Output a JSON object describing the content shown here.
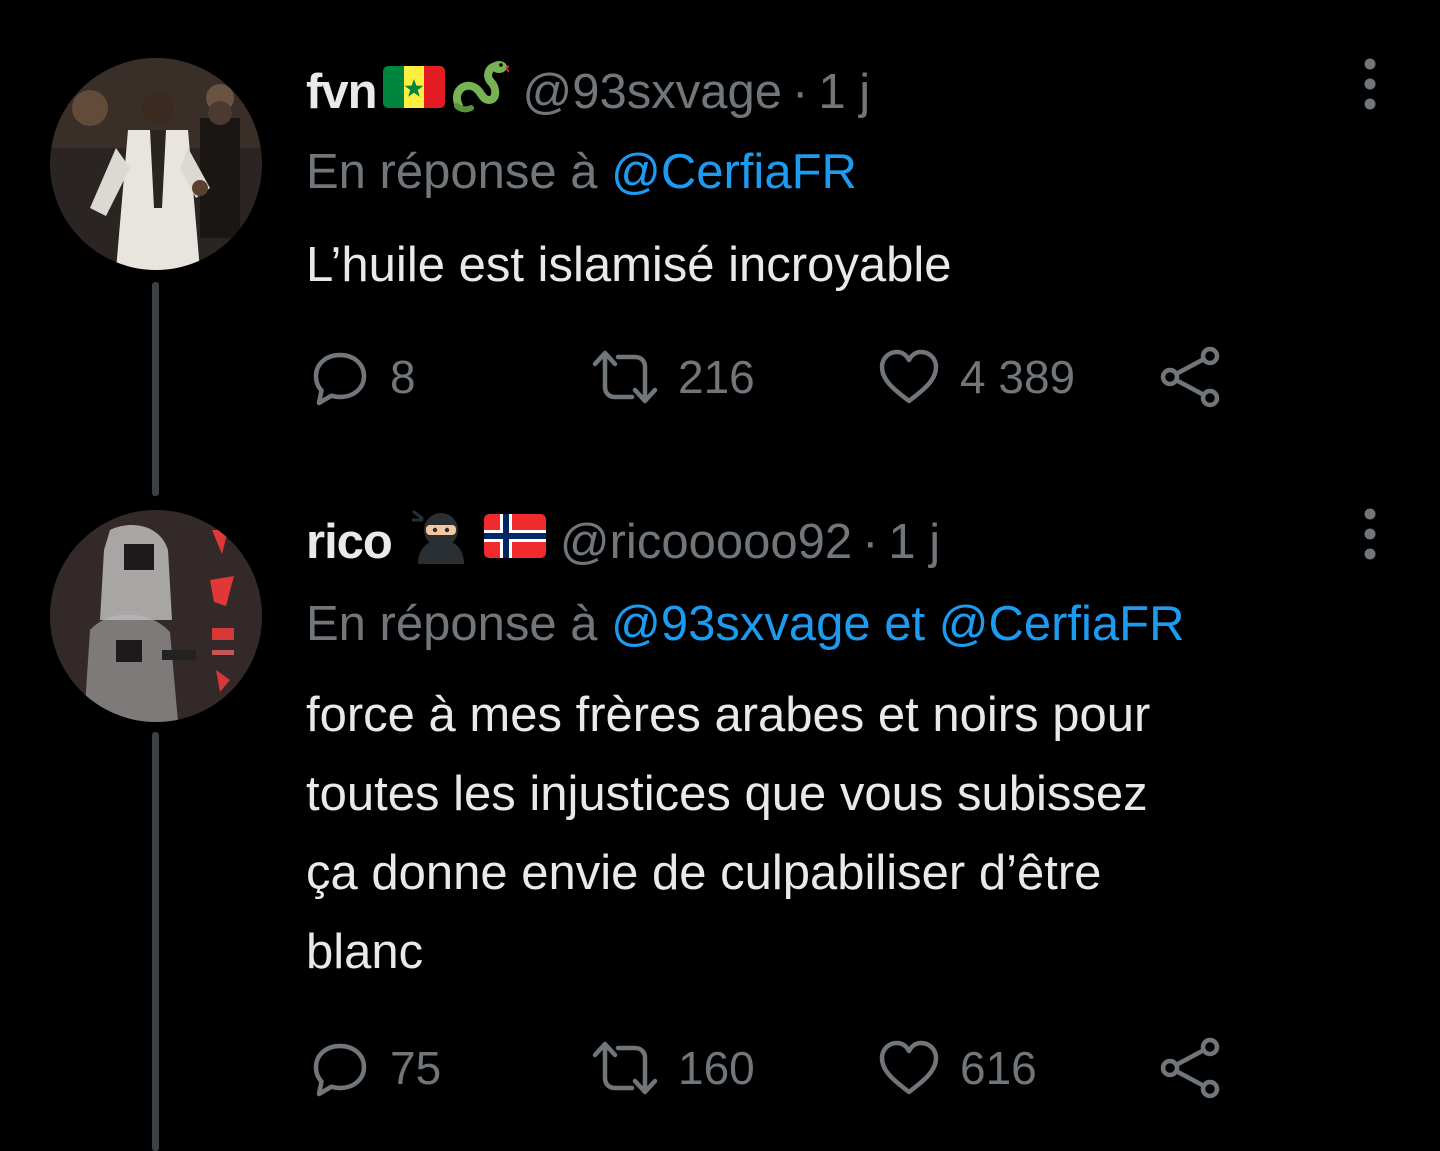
{
  "tweets": [
    {
      "display_name": "fvn",
      "emojis": [
        "senegal-flag",
        "snake"
      ],
      "handle": "@93sxvage",
      "separator": "·",
      "time": "1 j",
      "reply_prefix": "En réponse à",
      "reply_mentions": "@CerfiaFR",
      "text": "L’huile est islamisé incroyable",
      "replies": "8",
      "retweets": "216",
      "likes": "4 389"
    },
    {
      "display_name": "rico",
      "emojis": [
        "ninja",
        "norway-flag"
      ],
      "handle": "@ricooooo92",
      "separator": "·",
      "time": "1 j",
      "reply_prefix": "En réponse à",
      "reply_mentions": "@93sxvage et @CerfiaFR",
      "text": "force à mes frères arabes et noirs pour\ntoutes les injustices que vous  subissez\nça donne envie de culpabiliser d’être\nblanc",
      "replies": "75",
      "retweets": "160",
      "likes": "616"
    }
  ],
  "colors": {
    "background": "#000000",
    "text_primary": "#e7e9ea",
    "text_secondary": "#71767b",
    "link": "#1d9bf0",
    "thread_line": "#3e4144"
  }
}
